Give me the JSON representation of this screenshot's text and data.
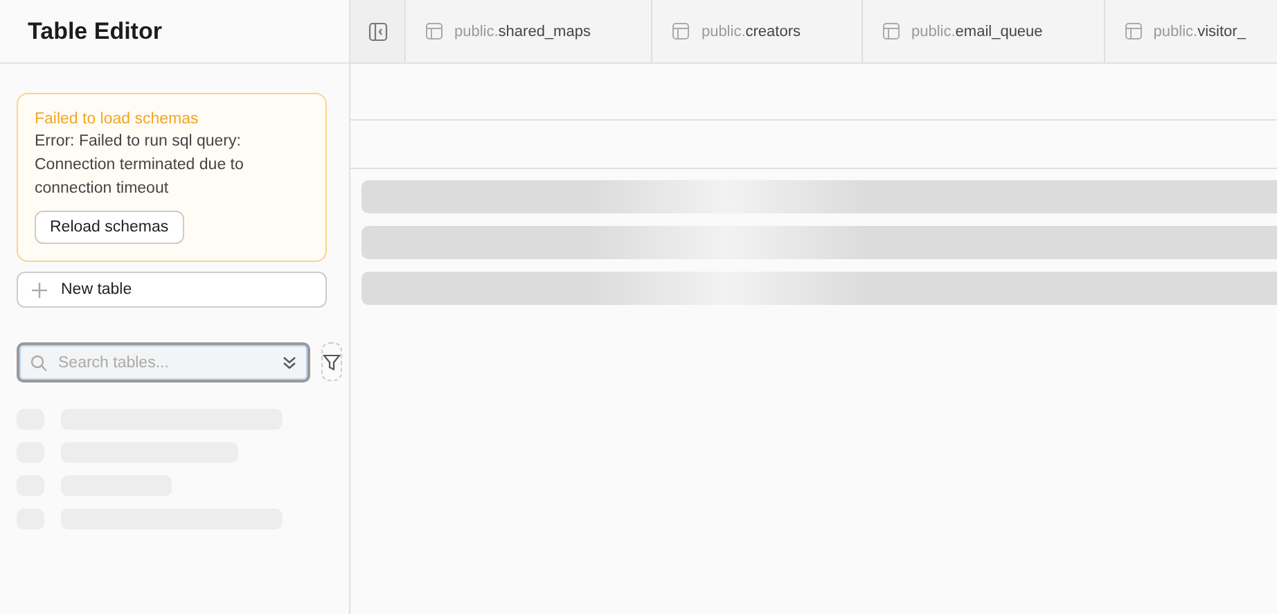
{
  "sidebar": {
    "title": "Table Editor",
    "alert": {
      "title": "Failed to load schemas",
      "message": "Error: Failed to run sql query: Connection terminated due to connection timeout",
      "button": "Reload schemas"
    },
    "new_table_button": "New table",
    "search": {
      "placeholder": "Search tables..."
    }
  },
  "tabs": [
    {
      "schema": "public.",
      "name": "shared_maps"
    },
    {
      "schema": "public.",
      "name": "creators"
    },
    {
      "schema": "public.",
      "name": "email_queue"
    },
    {
      "schema": "public.",
      "name": "visitor_"
    }
  ]
}
